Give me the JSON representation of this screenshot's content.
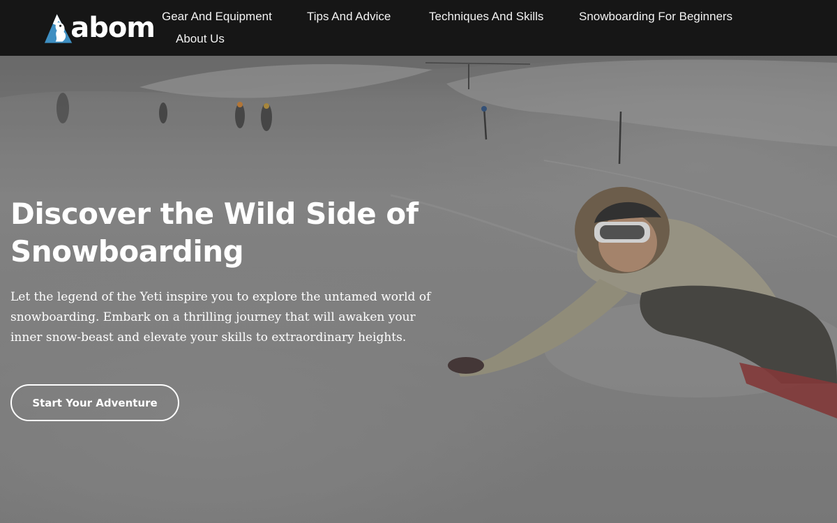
{
  "brand": {
    "logo_text": "abom",
    "logo_icon": "yeti-mountain-icon"
  },
  "nav": {
    "items": [
      {
        "label": "Gear And Equipment"
      },
      {
        "label": "Tips And Advice"
      },
      {
        "label": "Techniques And Skills"
      },
      {
        "label": "Snowboarding For Beginners"
      },
      {
        "label": "About Us"
      }
    ]
  },
  "hero": {
    "title": "Discover the Wild Side of Snowboarding",
    "description": "Let the legend of the Yeti inspire you to explore the untamed world of snowboarding. Embark on a thrilling journey that will awaken your inner snow-beast and elevate your skills to extraordinary heights.",
    "cta_label": "Start Your Adventure",
    "background": "snowboarder-carving-snowy-slope-photo"
  },
  "colors": {
    "topbar": "#161616",
    "text": "#ffffff",
    "logo_blue": "#3e8fc2"
  }
}
